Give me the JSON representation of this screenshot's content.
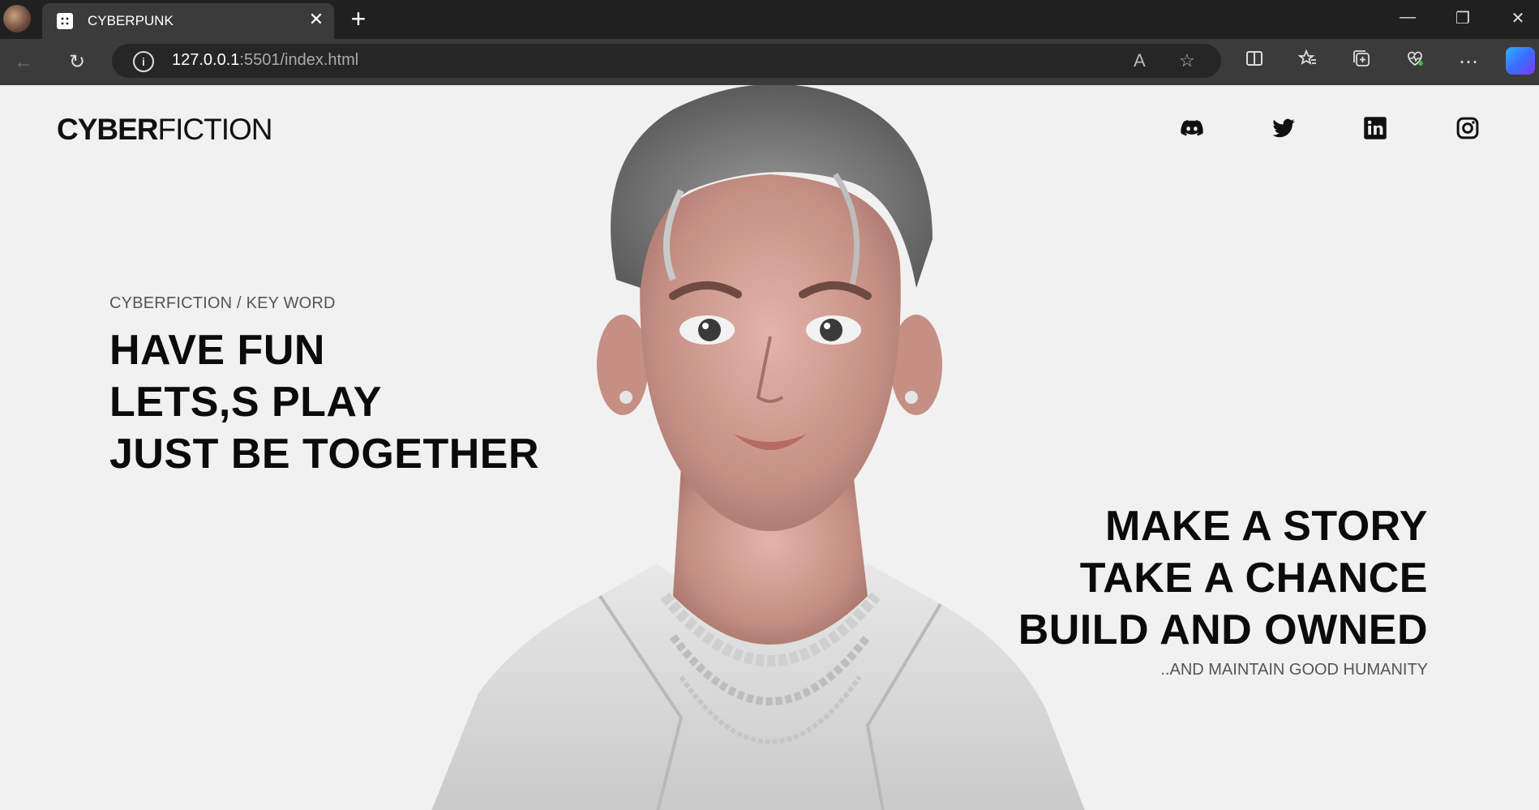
{
  "browser": {
    "tab": {
      "title": "CYBERPUNK",
      "close": "✕"
    },
    "new_tab": "+",
    "window_controls": {
      "minimize": "—",
      "maximize": "❐",
      "close": "✕"
    },
    "toolbar": {
      "back": "←",
      "reload": "↻",
      "more": "⋯"
    },
    "address": {
      "host": "127.0.0.1",
      "path": ":5501/index.html"
    }
  },
  "header": {
    "logo_bold": "CYBER",
    "logo_light": "FICTION",
    "social": [
      "discord-icon",
      "twitter-icon",
      "linkedin-icon",
      "instagram-icon"
    ]
  },
  "hero": {
    "kicker": "CYBERFICTION / KEY WORD",
    "left_lines": [
      "HAVE FUN",
      "LETS,S PLAY",
      "JUST BE TOGETHER"
    ],
    "right_lines": [
      "MAKE A STORY",
      "TAKE A CHANCE",
      "BUILD AND OWNED"
    ],
    "tagline": "..AND MAINTAIN GOOD HUMANITY"
  },
  "colors": {
    "page_bg": "#f1f1f1",
    "text": "#0b0b0b",
    "chrome": "#202020"
  }
}
